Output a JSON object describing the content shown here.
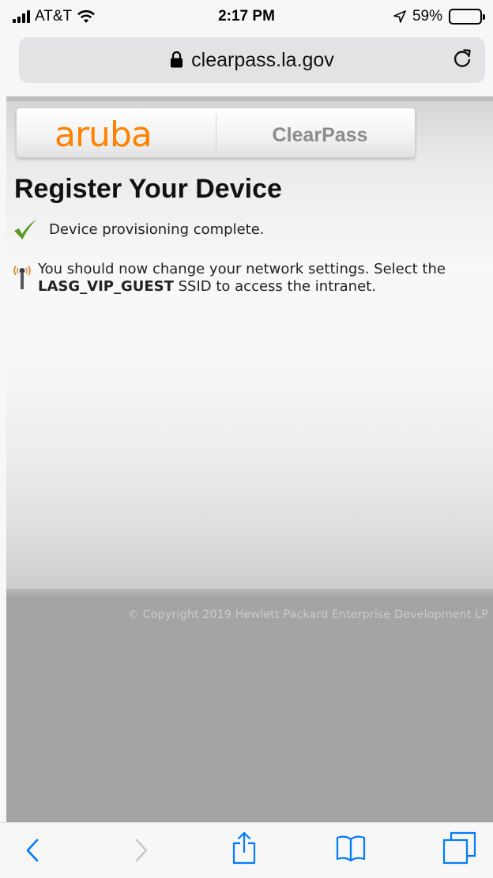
{
  "status": {
    "carrier": "AT&T",
    "time": "2:17 PM",
    "battery": "59%",
    "battery_level": 0.59
  },
  "browser": {
    "url": "clearpass.la.gov"
  },
  "header": {
    "brand": "aruba",
    "product": "ClearPass"
  },
  "page": {
    "title": "Register Your Device",
    "msg1": "Device provisioning complete.",
    "msg2_pre": "You should now change your network settings. Select the ",
    "ssid": "LASG_VIP_GUEST",
    "msg2_post": " SSID to access the intranet."
  },
  "footer": {
    "copyright": "© Copyright 2019 Hewlett Packard Enterprise Development LP"
  },
  "colors": {
    "brand_orange": "#ff8300",
    "ios_blue": "#007aff",
    "check_green": "#5a9a25"
  },
  "icons": [
    "signal-icon",
    "wifi-icon",
    "location-icon",
    "battery-icon",
    "lock-icon",
    "reload-icon",
    "check-icon",
    "wifi-antenna-icon",
    "back-icon",
    "forward-icon",
    "share-icon",
    "bookmarks-icon",
    "tabs-icon"
  ]
}
